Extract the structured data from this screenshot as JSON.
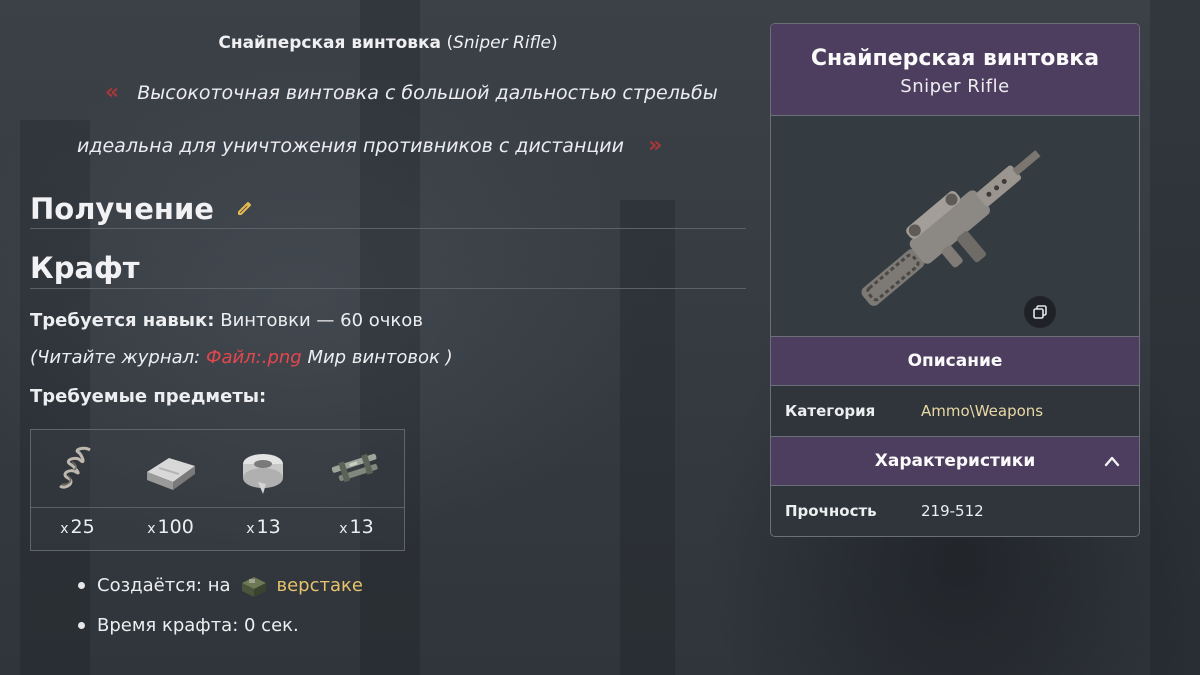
{
  "quote": {
    "title_ru": "Снайперская винтовка",
    "title_en": "Sniper Rifle",
    "open_mark": "«",
    "line1": "Высокоточная винтовка с большой дальностью стрельбы",
    "line2": "идеальна для уничтожения противников с дистанции",
    "close_mark": "»"
  },
  "sections": {
    "obtaining": "Получение",
    "craft": "Крафт"
  },
  "craft": {
    "skill_label": "Требуется навык:",
    "skill_value": "Винтовки — 60 очков",
    "journal_prefix": "(Читайте журнал: ",
    "journal_link": "Файл:.png",
    "journal_suffix": " Мир винтовок )",
    "items_label": "Требуемые предметы:",
    "items": [
      {
        "icon": "spring-icon",
        "x": "x",
        "count": "25"
      },
      {
        "icon": "metal-ingot-icon",
        "x": "x",
        "count": "100"
      },
      {
        "icon": "duct-tape-icon",
        "x": "x",
        "count": "13"
      },
      {
        "icon": "rifle-parts-icon",
        "x": "x",
        "count": "13"
      }
    ],
    "created_label": "Создаётся: на",
    "created_link": "верстаке",
    "time_label": "Время крафта: 0 сек."
  },
  "infobox": {
    "title": "Снайперская винтовка",
    "subtitle": "Sniper Rifle",
    "description_header": "Описание",
    "category_key": "Категория",
    "category_value": "Ammo\\Weapons",
    "characteristics_header": "Характеристики",
    "durability_key": "Прочность",
    "durability_value": "219-512"
  },
  "colors": {
    "accent_purple": "#4d3e5f",
    "link_red": "#e4474d",
    "link_gold": "#e6c26a",
    "background": "#343a40"
  }
}
